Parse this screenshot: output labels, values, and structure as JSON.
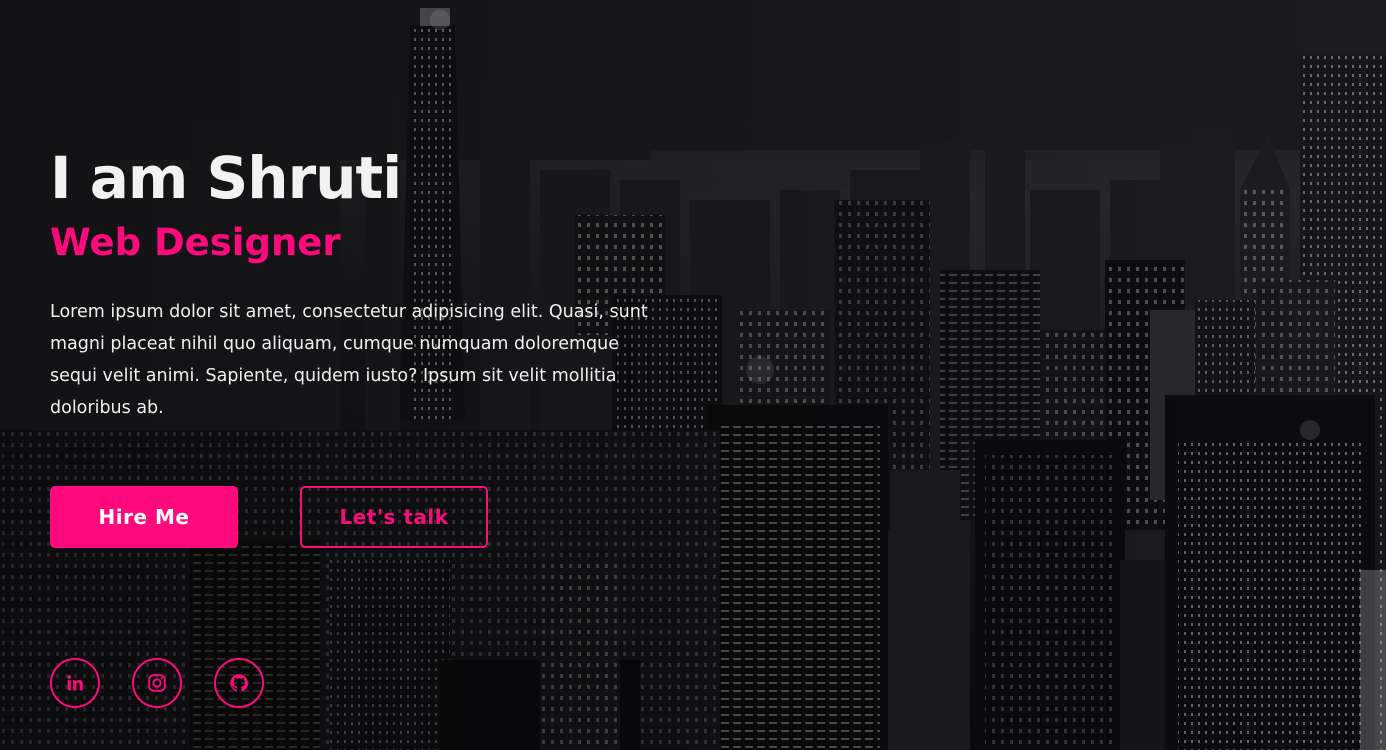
{
  "hero": {
    "title": "I am Shruti",
    "subtitle": "Web Designer",
    "description": "Lorem ipsum dolor sit amet, consectetur adipisicing elit. Quasi, sunt magni placeat nihil quo aliquam, cumque numquam doloremque sequi velit animi. Sapiente, quidem iusto? Ipsum sit velit mollitia doloribus ab."
  },
  "buttons": {
    "hire_label": "Hire Me",
    "talk_label": "Let's talk"
  },
  "socials": [
    {
      "icon": "linkedin-icon"
    },
    {
      "icon": "instagram-icon"
    },
    {
      "icon": "github-icon"
    }
  ],
  "colors": {
    "accent": "#ff0a7c",
    "title": "#f2f2f2",
    "text": "#f0f0f0",
    "background": "#0d0d10"
  }
}
